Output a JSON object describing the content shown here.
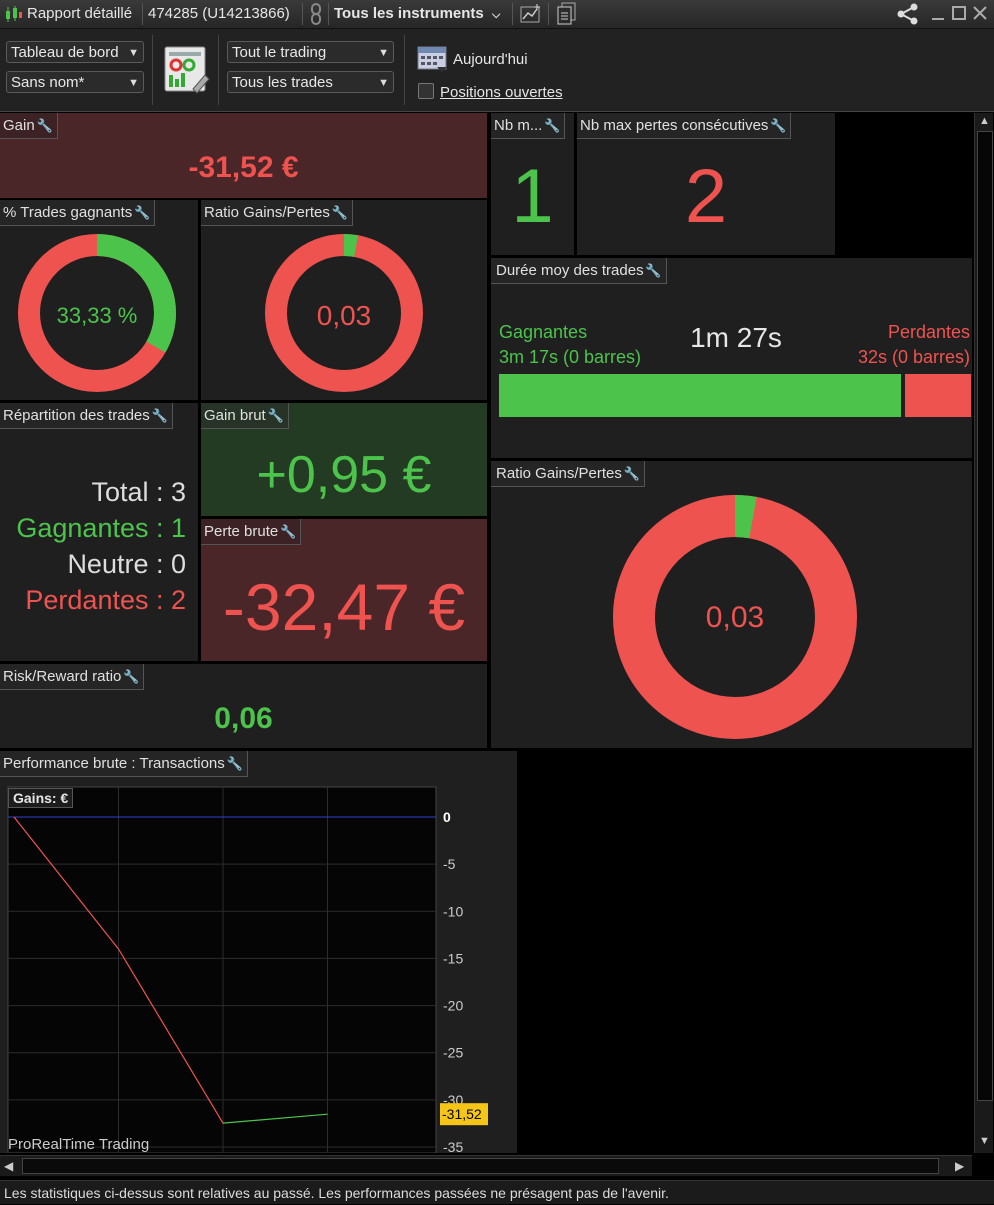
{
  "titlebar": {
    "report_title": "Rapport détaillé",
    "account": "474285 (U14213866)",
    "instruments": "Tous les instruments"
  },
  "toolbar": {
    "dashboard_select": "Tableau de bord",
    "name_select": "Sans nom*",
    "trading_select": "Tout le trading",
    "trades_select": "Tous les trades",
    "date_label": "Aujourd'hui",
    "open_positions_label": "Positions ouvertes",
    "open_positions_checked": false
  },
  "panels": {
    "gain": {
      "title": "Gain",
      "value": "-31,52 €"
    },
    "pct_winning": {
      "title": "% Trades gagnants",
      "value": "33,33 %",
      "fraction": 0.3333
    },
    "ratio_small": {
      "title": "Ratio Gains/Pertes",
      "value": "0,03",
      "fraction": 0.0284
    },
    "nb_max_gains": {
      "title": "Nb m...",
      "value": "1"
    },
    "nb_max_losses": {
      "title": "Nb max pertes consécutives",
      "value": "2"
    },
    "avg_duration": {
      "title": "Durée moy des trades",
      "winning_label": "Gagnantes",
      "winning_value": "3m 17s (0 barres)",
      "average": "1m 27s",
      "losing_label": "Perdantes",
      "losing_value": "32s (0 barres)",
      "winning_fraction": 0.86
    },
    "distribution": {
      "title": "Répartition des trades",
      "total_label": "Total : 3",
      "winning_label": "Gagnantes : 1",
      "neutral_label": "Neutre : 0",
      "losing_label": "Perdantes : 2"
    },
    "gross_gain": {
      "title": "Gain brut",
      "value": "+0,95 €"
    },
    "gross_loss": {
      "title": "Perte brute",
      "value": "-32,47 €"
    },
    "ratio_large": {
      "title": "Ratio Gains/Pertes",
      "value": "0,03",
      "fraction": 0.0284
    },
    "risk_reward": {
      "title": "Risk/Reward ratio",
      "value": "0,06"
    }
  },
  "performance": {
    "title": "Performance brute : Transactions",
    "legend": "Gains: €",
    "watermark": "ProRealTime Trading",
    "last_value_label": "-31,52"
  },
  "chart_data": {
    "type": "line",
    "x": [
      0,
      1,
      2,
      3
    ],
    "y": [
      0,
      -14,
      -32.47,
      -31.52
    ],
    "segment_colors": [
      "#ef5350",
      "#ef5350",
      "#4cc44c"
    ],
    "ylim": [
      -35,
      0
    ],
    "yticks": [
      0,
      -5,
      -10,
      -15,
      -20,
      -25,
      -30,
      -35
    ],
    "ytick_labels": [
      "0",
      "-5",
      "-10",
      "-15",
      "-20",
      "-25",
      "-30",
      "-35"
    ],
    "xlim": [
      0,
      4
    ],
    "zero_line_color": "#3040d0",
    "grid": true
  },
  "footer": {
    "disclaimer": "Les statistiques ci-dessus sont relatives au passé. Les performances passées ne présagent pas de l'avenir."
  },
  "colors": {
    "red": "#ef5350",
    "green": "#4cc44c",
    "gain_bg": "#4a2628",
    "gross_gain_bg": "#233a23"
  }
}
